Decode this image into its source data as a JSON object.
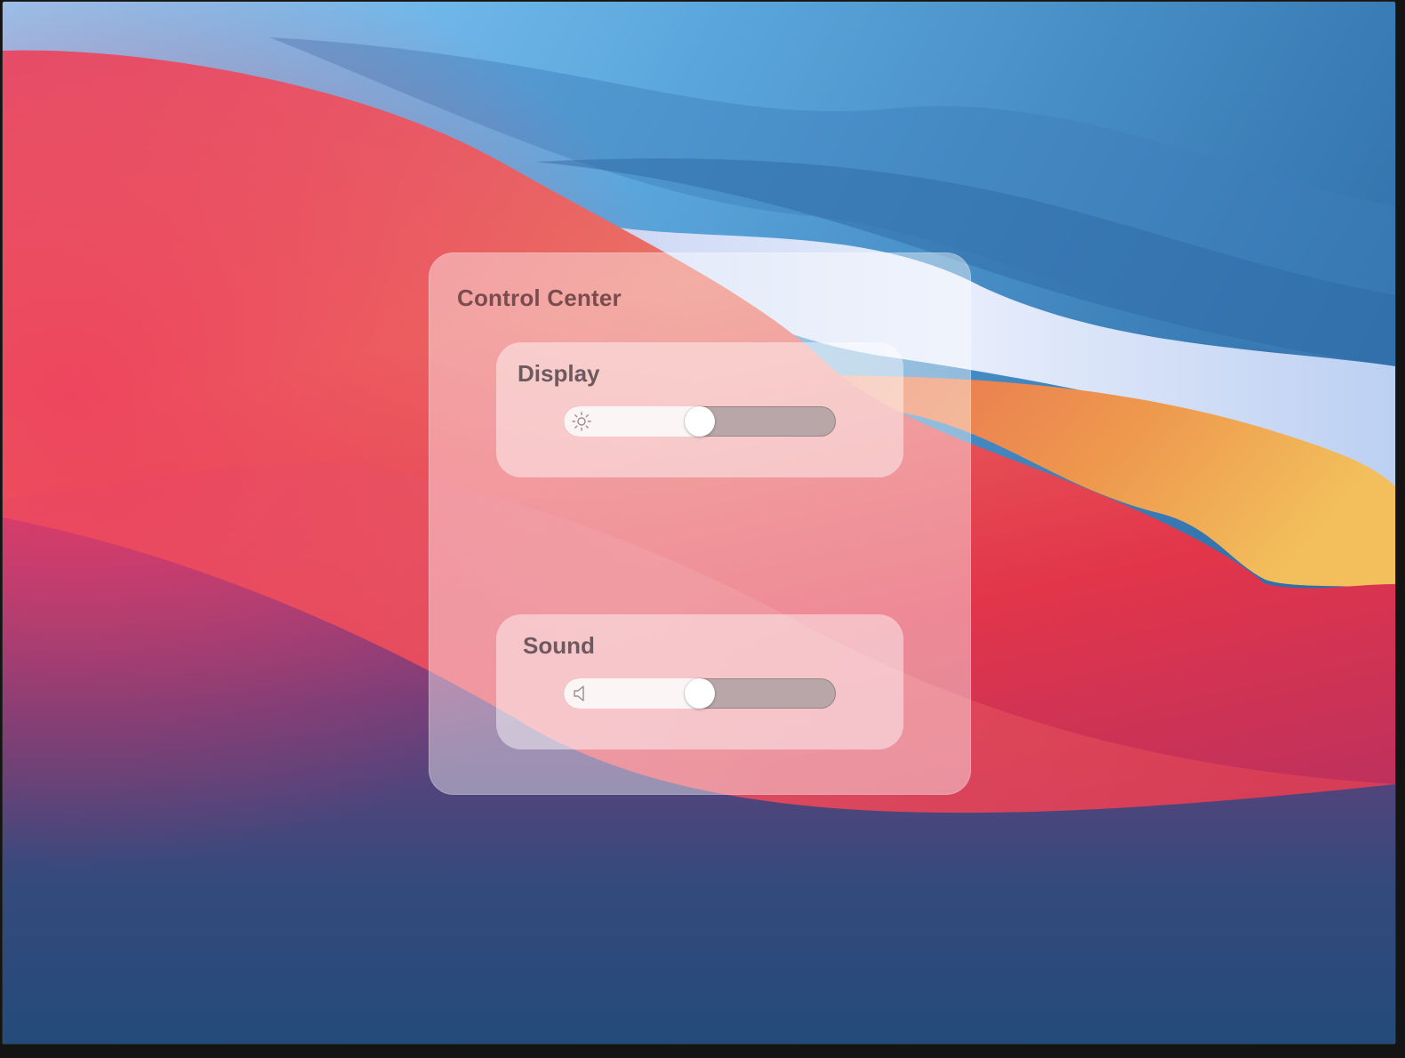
{
  "control_center": {
    "title": "Control Center",
    "display": {
      "label": "Display",
      "icon": "sun-icon",
      "brightness_fraction": 0.5
    },
    "sound": {
      "label": "Sound",
      "icon": "speaker-icon",
      "volume_fraction": 0.5
    }
  },
  "colors": {
    "panel_title": "#7a4c4e",
    "module_label": "#6c5a5e",
    "slider_fill": "#fbf5f5",
    "slider_track": "#b8a6a8"
  }
}
